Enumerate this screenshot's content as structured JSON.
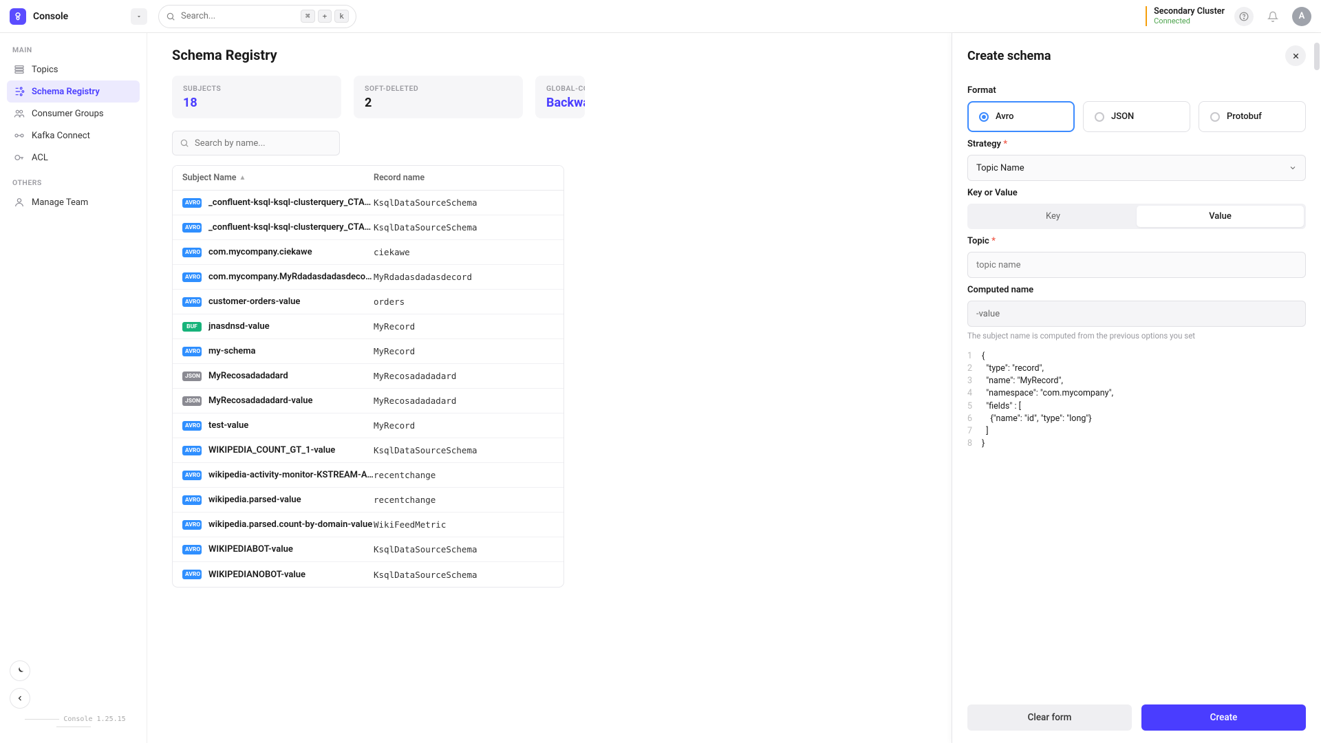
{
  "app": {
    "name": "Console",
    "version": "Console 1.25.15"
  },
  "cluster": {
    "name": "Secondary Cluster",
    "status": "Connected"
  },
  "search": {
    "placeholder": "Search...",
    "kbd1": "⌘",
    "kbdplus": "+",
    "kbd2": "k"
  },
  "avatar": {
    "initial": "A"
  },
  "sidebar": {
    "sections": [
      {
        "title": "MAIN",
        "items": [
          {
            "label": "Topics"
          },
          {
            "label": "Schema Registry",
            "active": true
          },
          {
            "label": "Consumer Groups"
          },
          {
            "label": "Kafka Connect"
          },
          {
            "label": "ACL"
          }
        ]
      },
      {
        "title": "OTHERS",
        "items": [
          {
            "label": "Manage Team"
          }
        ]
      }
    ]
  },
  "page": {
    "title": "Schema Registry",
    "stats": [
      {
        "label": "SUBJECTS",
        "value": "18"
      },
      {
        "label": "SOFT-DELETED",
        "value": "2"
      },
      {
        "label": "GLOBAL-COMPATIBILITY",
        "value": "Backward"
      }
    ],
    "search_placeholder": "Search by name...",
    "columns": {
      "subject": "Subject Name",
      "record": "Record name"
    },
    "rows": [
      {
        "type": "AVRO",
        "badge": "avro",
        "subject": "_confluent-ksql-ksql-clusterquery_CTAS_...",
        "record": "KsqlDataSourceSchema"
      },
      {
        "type": "AVRO",
        "badge": "avro",
        "subject": "_confluent-ksql-ksql-clusterquery_CTAS_...",
        "record": "KsqlDataSourceSchema"
      },
      {
        "type": "AVRO",
        "badge": "avro",
        "subject": "com.mycompany.ciekawe",
        "record": "ciekawe"
      },
      {
        "type": "AVRO",
        "badge": "avro",
        "subject": "com.mycompany.MyRdadasdadasdecord",
        "record": "MyRdadasdadasdecord"
      },
      {
        "type": "AVRO",
        "badge": "avro",
        "subject": "customer-orders-value",
        "record": "orders"
      },
      {
        "type": "BUF",
        "badge": "buf",
        "subject": "jnasdnsd-value",
        "record": "MyRecord"
      },
      {
        "type": "AVRO",
        "badge": "avro",
        "subject": "my-schema",
        "record": "MyRecord"
      },
      {
        "type": "JSON",
        "badge": "json",
        "subject": "MyRecosadadadard",
        "record": "MyRecosadadadard"
      },
      {
        "type": "JSON",
        "badge": "json",
        "subject": "MyRecosadadadard-value",
        "record": "MyRecosadadadard"
      },
      {
        "type": "AVRO",
        "badge": "avro",
        "subject": "test-value",
        "record": "MyRecord"
      },
      {
        "type": "AVRO",
        "badge": "avro",
        "subject": "WIKIPEDIA_COUNT_GT_1-value",
        "record": "KsqlDataSourceSchema"
      },
      {
        "type": "AVRO",
        "badge": "avro",
        "subject": "wikipedia-activity-monitor-KSTREAM-AG...",
        "record": "recentchange"
      },
      {
        "type": "AVRO",
        "badge": "avro",
        "subject": "wikipedia.parsed-value",
        "record": "recentchange"
      },
      {
        "type": "AVRO",
        "badge": "avro",
        "subject": "wikipedia.parsed.count-by-domain-value",
        "record": "WikiFeedMetric"
      },
      {
        "type": "AVRO",
        "badge": "avro",
        "subject": "WIKIPEDIABOT-value",
        "record": "KsqlDataSourceSchema"
      },
      {
        "type": "AVRO",
        "badge": "avro",
        "subject": "WIKIPEDIANOBOT-value",
        "record": "KsqlDataSourceSchema"
      }
    ]
  },
  "panel": {
    "title": "Create schema",
    "format": {
      "label": "Format",
      "options": [
        "Avro",
        "JSON",
        "Protobuf"
      ],
      "selected": "Avro"
    },
    "strategy": {
      "label": "Strategy",
      "value": "Topic Name"
    },
    "keyvalue": {
      "label": "Key or Value",
      "options": [
        "Key",
        "Value"
      ],
      "selected": "Value"
    },
    "topic": {
      "label": "Topic",
      "placeholder": "topic name"
    },
    "computed": {
      "label": "Computed name",
      "value": "-value",
      "hint": "The subject name is computed from the previous options you set"
    },
    "code": {
      "lines": [
        "{",
        "  \"type\": \"record\",",
        "  \"name\": \"MyRecord\",",
        "  \"namespace\": \"com.mycompany\",",
        "  \"fields\" : [",
        "    {\"name\": \"id\", \"type\": \"long\"}",
        "  ]",
        "}"
      ]
    },
    "buttons": {
      "clear": "Clear form",
      "create": "Create"
    }
  }
}
